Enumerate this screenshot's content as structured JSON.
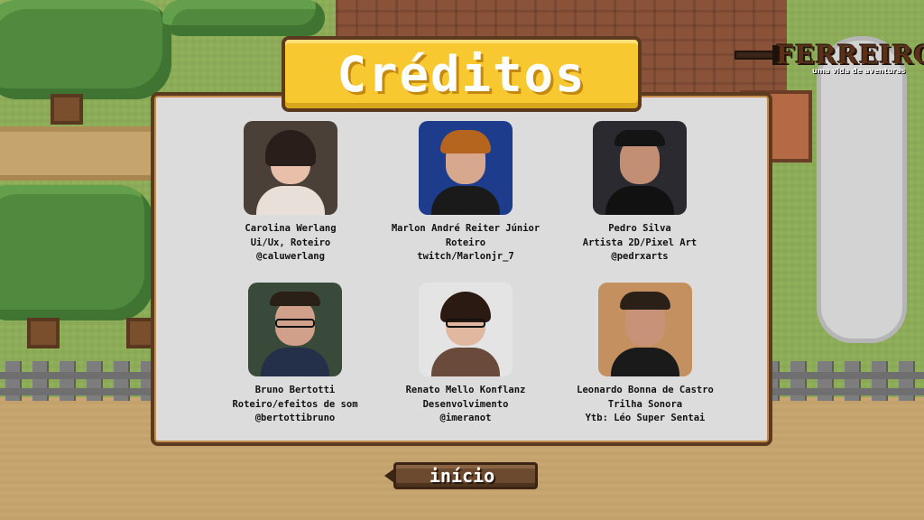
{
  "screen": {
    "name": "credits"
  },
  "title": "Créditos",
  "logo": {
    "title": "FERREIRO",
    "subtitle": "uma vida de aventuras"
  },
  "credits": [
    {
      "name": "Carolina Werlang",
      "role": "Ui/Ux, Roteiro",
      "handle": "@caluwerlang"
    },
    {
      "name": "Marlon André Reiter Júnior",
      "role": "Roteiro",
      "handle": "twitch/Marlonjr_7"
    },
    {
      "name": "Pedro Silva",
      "role": "Artista 2D/Pixel Art",
      "handle": "@pedrxarts"
    },
    {
      "name": "Bruno Bertotti",
      "role": "Roteiro/efeitos de som",
      "handle": "@bertottibruno"
    },
    {
      "name": "Renato Mello Konflanz",
      "role": "Desenvolvimento",
      "handle": "@imeranot"
    },
    {
      "name": "Leonardo Bonna de Castro",
      "role": "Trilha Sonora",
      "handle": "Ytb: Léo Super Sentai"
    }
  ],
  "start_button": {
    "label": "início"
  },
  "colors": {
    "banner": "#f7c830",
    "panel": "#dcdcdc",
    "border": "#5c3a1e"
  }
}
